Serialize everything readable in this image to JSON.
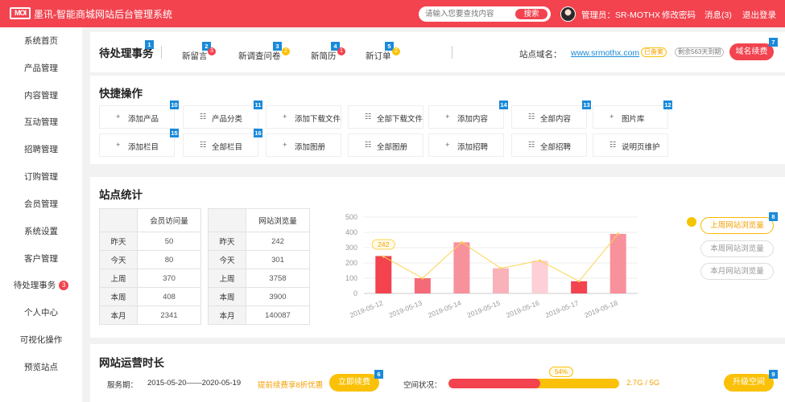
{
  "app": {
    "logo_text": "MOI",
    "title": "墨讯-智能商城网站后台管理系统"
  },
  "search": {
    "placeholder": "请输入您要查找内容",
    "button": "搜索"
  },
  "user": {
    "admin_label": "管理员：SR-MOTHX",
    "change_password": "修改密码",
    "messages": "消息(3)",
    "logout": "退出登录"
  },
  "sidebar": {
    "items": [
      {
        "label": "系统首页"
      },
      {
        "label": "产品管理"
      },
      {
        "label": "内容管理"
      },
      {
        "label": "互动管理"
      },
      {
        "label": "招聘管理"
      },
      {
        "label": "订购管理"
      },
      {
        "label": "会员管理"
      },
      {
        "label": "系统设置"
      },
      {
        "label": "客户管理"
      },
      {
        "label": "待处理事务",
        "badge": "3"
      },
      {
        "label": "个人中心"
      },
      {
        "label": "可视化操作"
      },
      {
        "label": "预览站点"
      }
    ]
  },
  "pending": {
    "title": "待处理事务",
    "title_tag": "1",
    "tabs": [
      {
        "label": "新留言",
        "tag": "2",
        "count": "3"
      },
      {
        "label": "新调查问卷",
        "tag": "3",
        "count": "2"
      },
      {
        "label": "新简历",
        "tag": "4",
        "count": "1"
      },
      {
        "label": "新订单",
        "tag": "5",
        "count": "2"
      }
    ],
    "domain_label": "站点域名：",
    "domain": "www.srmothx.com",
    "status_badge": "已备案",
    "remaining_badge": "剩余563天到期",
    "renew_button": "域名续费",
    "renew_tag": "7"
  },
  "quick": {
    "title": "快捷操作",
    "rows": [
      [
        {
          "icon": "+",
          "label": "添加产品",
          "tag": "10"
        },
        {
          "icon": "☷",
          "label": "产品分类",
          "tag": "11"
        },
        {
          "icon": "+",
          "label": "添加下载文件",
          "tag": ""
        },
        {
          "icon": "☷",
          "label": "全部下载文件",
          "tag": ""
        },
        {
          "icon": "+",
          "label": "添加内容",
          "tag": "14"
        },
        {
          "icon": "☷",
          "label": "全部内容",
          "tag": "13"
        },
        {
          "icon": "+",
          "label": "图片库",
          "tag": "12"
        }
      ],
      [
        {
          "icon": "+",
          "label": "添加栏目",
          "tag": "15"
        },
        {
          "icon": "☷",
          "label": "全部栏目",
          "tag": "16"
        },
        {
          "icon": "+",
          "label": "添加图册",
          "tag": ""
        },
        {
          "icon": "☷",
          "label": "全部图册",
          "tag": ""
        },
        {
          "icon": "+",
          "label": "添加招聘",
          "tag": ""
        },
        {
          "icon": "☷",
          "label": "全部招聘",
          "tag": ""
        },
        {
          "icon": "☷",
          "label": "说明页维护",
          "tag": ""
        }
      ]
    ]
  },
  "stats": {
    "title": "站点统计",
    "member_table": {
      "header": "会员访问量",
      "rows": [
        {
          "label": "昨天",
          "value": "50"
        },
        {
          "label": "今天",
          "value": "80"
        },
        {
          "label": "上周",
          "value": "370"
        },
        {
          "label": "本周",
          "value": "408"
        },
        {
          "label": "本月",
          "value": "2341"
        }
      ]
    },
    "browse_table": {
      "header": "网站浏览量",
      "rows": [
        {
          "label": "昨天",
          "value": "242"
        },
        {
          "label": "今天",
          "value": "301"
        },
        {
          "label": "上周",
          "value": "3758"
        },
        {
          "label": "本周",
          "value": "3900"
        },
        {
          "label": "本月",
          "value": "140087"
        }
      ]
    },
    "pills": [
      "上周网站浏览量",
      "本周网站浏览量",
      "本月网站浏览量"
    ],
    "pill_tag": "8"
  },
  "chart_data": {
    "type": "bar",
    "categories": [
      "2019-05-12",
      "2019-05-13",
      "2019-05-14",
      "2019-05-15",
      "2019-05-16",
      "2019-05-17",
      "2019-05-18"
    ],
    "values": [
      245,
      100,
      335,
      165,
      215,
      80,
      390
    ],
    "line_values": [
      242,
      100,
      335,
      165,
      215,
      80,
      390
    ],
    "ylim": [
      0,
      500
    ],
    "yticks": [
      0,
      100,
      200,
      300,
      400,
      500
    ],
    "highlight_label": "242",
    "bar_colors": [
      "#f2434f",
      "#f46a78",
      "#f7929d",
      "#f9b2ba",
      "#fcd0d6",
      "#f2434f",
      "#f7929d"
    ],
    "line_color": "#fcd34d",
    "grid": true
  },
  "uptime": {
    "title": "网站运营时长",
    "service_label": "服务期：",
    "service_period": "2015-05-20——2020-05-19",
    "promo": "提前续费享8折优惠",
    "renew_button": "立即续费",
    "renew_tag": "6",
    "space_label": "空间状况：",
    "space_percent": 54,
    "space_percent_label": "54%",
    "space_value": "2.7G / 5G",
    "upgrade_button": "升级空间",
    "upgrade_tag": "9"
  }
}
